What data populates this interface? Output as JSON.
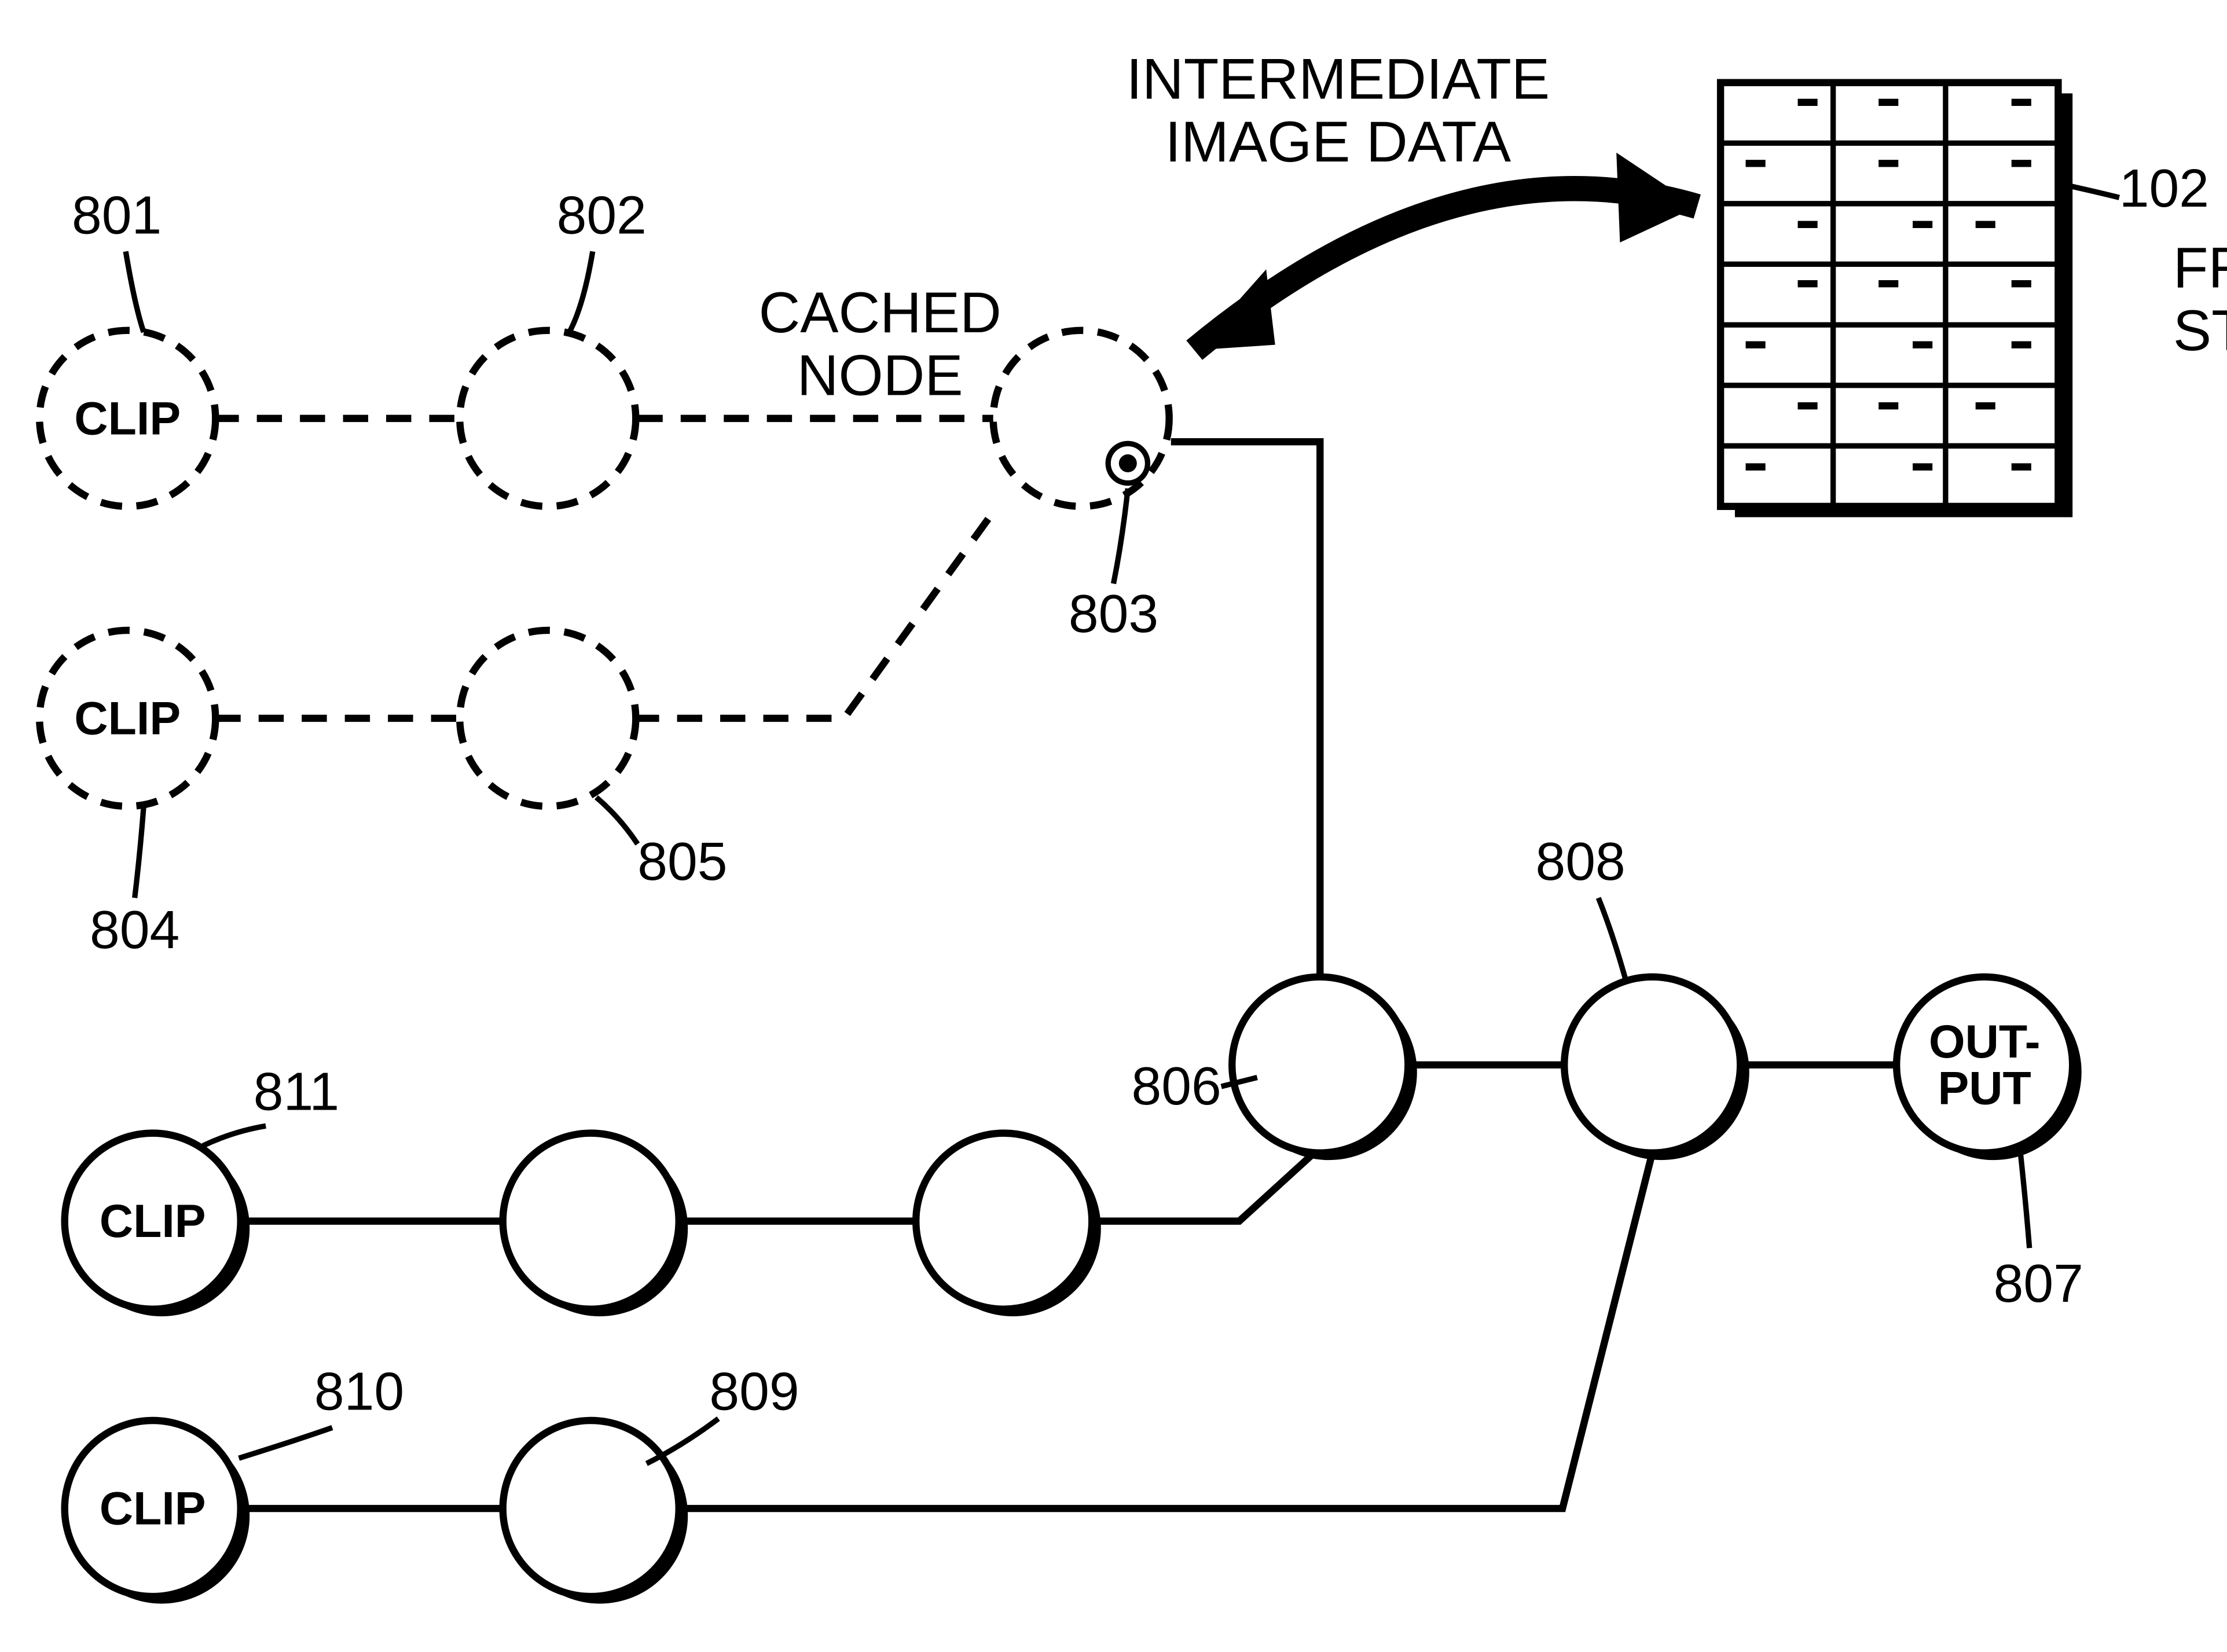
{
  "labels": {
    "intermediate1": "INTERMEDIATE",
    "intermediate2": "IMAGE  DATA",
    "frameStore1": "FRAME",
    "frameStore2": "STORE",
    "cachedNode1": "CACHED",
    "cachedNode2": "NODE",
    "clip": "CLIP",
    "output1": "OUT-",
    "output2": "PUT"
  },
  "refs": {
    "r801": "801",
    "r802": "802",
    "r803": "803",
    "r804": "804",
    "r805": "805",
    "r806": "806",
    "r807": "807",
    "r808": "808",
    "r809": "809",
    "r810": "810",
    "r811": "811",
    "r102": "102"
  }
}
